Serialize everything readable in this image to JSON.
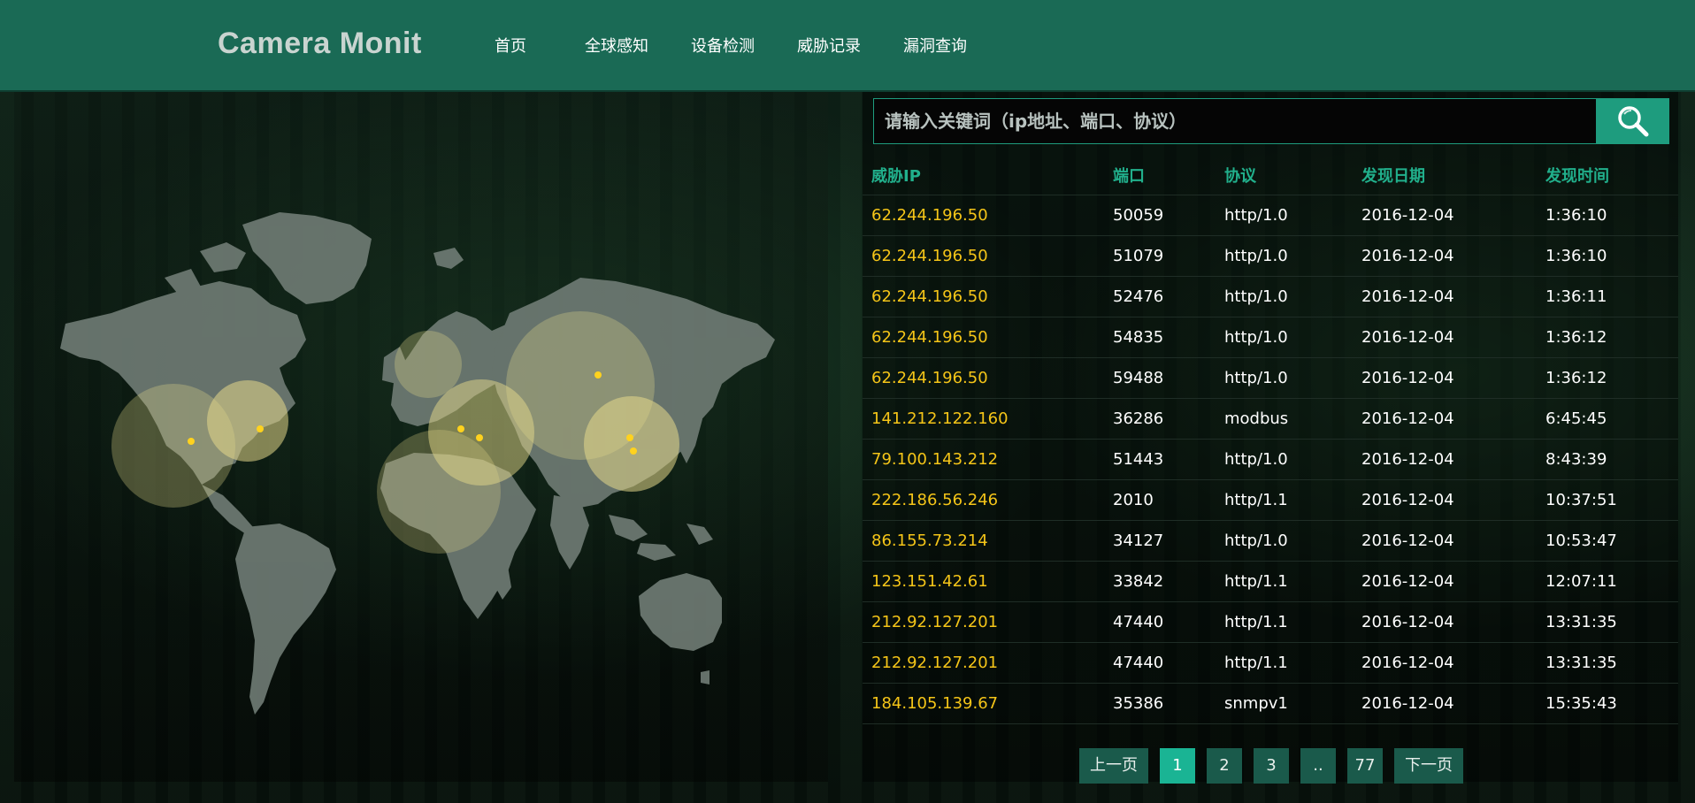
{
  "header": {
    "logo": "Camera Monit",
    "nav": [
      "首页",
      "全球感知",
      "设备检测",
      "威胁记录",
      "漏洞查询"
    ]
  },
  "search": {
    "placeholder": "请输入关键词（ip地址、端口、协议）",
    "button_icon": "search-icon"
  },
  "table": {
    "columns": [
      "威胁IP",
      "端口",
      "协议",
      "发现日期",
      "发现时间"
    ],
    "rows": [
      {
        "ip": "62.244.196.50",
        "port": "50059",
        "protocol": "http/1.0",
        "date": "2016-12-04",
        "time": "1:36:10"
      },
      {
        "ip": "62.244.196.50",
        "port": "51079",
        "protocol": "http/1.0",
        "date": "2016-12-04",
        "time": "1:36:10"
      },
      {
        "ip": "62.244.196.50",
        "port": "52476",
        "protocol": "http/1.0",
        "date": "2016-12-04",
        "time": "1:36:11"
      },
      {
        "ip": "62.244.196.50",
        "port": "54835",
        "protocol": "http/1.0",
        "date": "2016-12-04",
        "time": "1:36:12"
      },
      {
        "ip": "62.244.196.50",
        "port": "59488",
        "protocol": "http/1.0",
        "date": "2016-12-04",
        "time": "1:36:12"
      },
      {
        "ip": "141.212.122.160",
        "port": "36286",
        "protocol": "modbus",
        "date": "2016-12-04",
        "time": "6:45:45"
      },
      {
        "ip": "79.100.143.212",
        "port": "51443",
        "protocol": "http/1.0",
        "date": "2016-12-04",
        "time": "8:43:39"
      },
      {
        "ip": "222.186.56.246",
        "port": "2010",
        "protocol": "http/1.1",
        "date": "2016-12-04",
        "time": "10:37:51"
      },
      {
        "ip": "86.155.73.214",
        "port": "34127",
        "protocol": "http/1.0",
        "date": "2016-12-04",
        "time": "10:53:47"
      },
      {
        "ip": "123.151.42.61",
        "port": "33842",
        "protocol": "http/1.1",
        "date": "2016-12-04",
        "time": "12:07:11"
      },
      {
        "ip": "212.92.127.201",
        "port": "47440",
        "protocol": "http/1.1",
        "date": "2016-12-04",
        "time": "13:31:35"
      },
      {
        "ip": "212.92.127.201",
        "port": "47440",
        "protocol": "http/1.1",
        "date": "2016-12-04",
        "time": "13:31:35"
      },
      {
        "ip": "184.105.139.67",
        "port": "35386",
        "protocol": "snmpv1",
        "date": "2016-12-04",
        "time": "15:35:43"
      }
    ]
  },
  "pagination": {
    "prev": "上一页",
    "pages": [
      "1",
      "2",
      "3",
      "..",
      "77"
    ],
    "active": "1",
    "next": "下一页"
  },
  "colors": {
    "header": "#1a6a55",
    "accent": "#1e9c7e",
    "ip_text": "#f5c518",
    "column_header": "#21b08c",
    "map_land": "#6e7a73",
    "map_highlight": "#e6d98a",
    "map_point": "#ffd21e"
  }
}
